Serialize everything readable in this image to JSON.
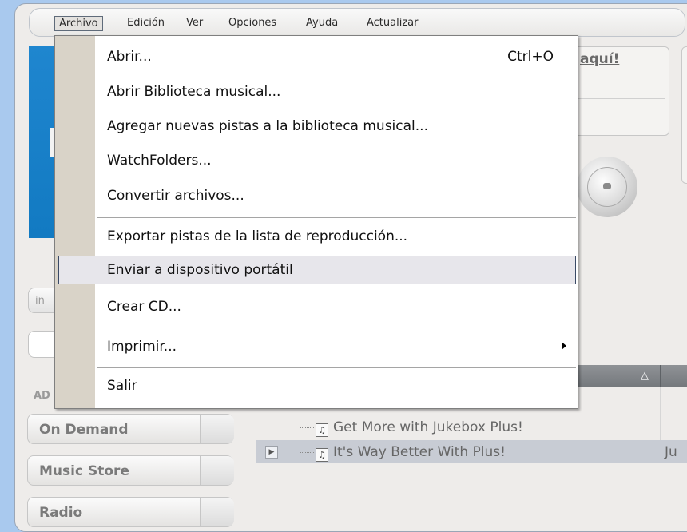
{
  "menubar": {
    "items": [
      {
        "label": "Archivo"
      },
      {
        "label": "Edición"
      },
      {
        "label": "Ver"
      },
      {
        "label": "Opciones"
      },
      {
        "label": "Ayuda"
      },
      {
        "label": "Actualizar"
      }
    ]
  },
  "banner": {
    "link_text": "aquí!"
  },
  "sidebar": {
    "small_button": "in",
    "section_label": "AD",
    "nav": [
      {
        "label": "On Demand"
      },
      {
        "label": "Music Store"
      },
      {
        "label": "Radio"
      }
    ]
  },
  "file_menu": {
    "items": [
      {
        "label": "Abrir...",
        "shortcut": "Ctrl+O"
      },
      {
        "label": "Abrir Biblioteca musical..."
      },
      {
        "label": "Agregar nuevas pistas a la biblioteca musical..."
      },
      {
        "label": "WatchFolders..."
      },
      {
        "label": "Convertir archivos..."
      },
      {
        "label": "Exportar pistas de la lista de reproducción..."
      },
      {
        "label": "Enviar a dispositivo portátil"
      },
      {
        "label": "Crear CD..."
      },
      {
        "label": "Imprimir..."
      },
      {
        "label": "Salir"
      }
    ]
  },
  "playlist": {
    "tracks": [
      {
        "title": "Get More with Jukebox Plus!"
      },
      {
        "title": "It's Way Better With Plus!",
        "extra": "Ju"
      }
    ]
  },
  "icons": {
    "note": "music-note-icon",
    "sort": "sort-triangle-icon",
    "play": "play-arrow-icon",
    "submenu": "submenu-arrow-icon"
  }
}
